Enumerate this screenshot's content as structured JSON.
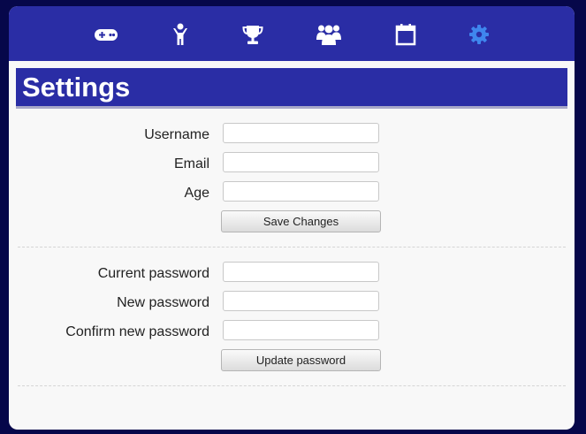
{
  "nav": {
    "items": [
      {
        "name": "games",
        "icon": "gamepad-icon",
        "active": false
      },
      {
        "name": "player",
        "icon": "person-icon",
        "active": false
      },
      {
        "name": "achievements",
        "icon": "trophy-icon",
        "active": false
      },
      {
        "name": "friends",
        "icon": "group-icon",
        "active": false
      },
      {
        "name": "calendar",
        "icon": "calendar-icon",
        "active": false
      },
      {
        "name": "settings",
        "icon": "gear-icon",
        "active": true
      }
    ],
    "icon_color": "#ffffff",
    "active_icon_color": "#3f86ee"
  },
  "page": {
    "title": "Settings"
  },
  "profile_form": {
    "username_label": "Username",
    "username_value": "",
    "email_label": "Email",
    "email_value": "",
    "age_label": "Age",
    "age_value": "",
    "save_label": "Save Changes"
  },
  "password_form": {
    "current_label": "Current password",
    "current_value": "",
    "new_label": "New password",
    "new_value": "",
    "confirm_label": "Confirm new password",
    "confirm_value": "",
    "update_label": "Update password"
  },
  "colors": {
    "background": "#06074a",
    "brand": "#2a2da5",
    "panel": "#f8f8f8"
  }
}
